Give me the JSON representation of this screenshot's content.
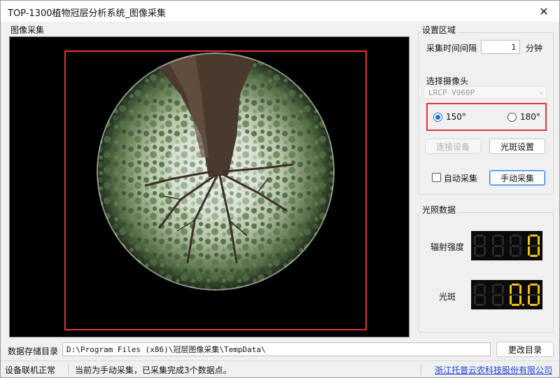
{
  "window": {
    "title": "TOP-1300植物冠层分析系统_图像采集",
    "close_glyph": "✕"
  },
  "capture_panel": {
    "label": "图像采集"
  },
  "settings": {
    "group_label": "设置区域",
    "interval_label": "采集时间间隔",
    "interval_value": "1",
    "interval_unit": "分钟",
    "camera_label": "选择摄像头",
    "camera_selected": "LRCP V960P",
    "lens_options": [
      {
        "label": "150°",
        "checked": true
      },
      {
        "label": "180°",
        "checked": false
      }
    ],
    "connect_button": "连接设备",
    "spot_settings_button": "光斑设置",
    "auto_capture_label": "自动采集",
    "auto_capture_checked": false,
    "manual_capture_button": "手动采集"
  },
  "light_data": {
    "group_label": "光照数据",
    "radiation_label": "辐射强度",
    "radiation_value": "0",
    "spot_label": "光斑",
    "spot_value": "0.0"
  },
  "storage": {
    "label": "数据存储目录",
    "path": "D:\\Program Files (x86)\\冠层图像采集\\TempData\\",
    "change_button": "更改目录"
  },
  "status": {
    "connection": "设备联机正常",
    "message": "当前为手动采集，已采集完成3个数据点。",
    "company": "浙江托普云农科技股份有限公司"
  },
  "colors": {
    "selection_border": "#e0343a",
    "lcd_on": "#f3c31a",
    "lcd_off": "#2a2a2a",
    "link": "#1a3fd8"
  }
}
